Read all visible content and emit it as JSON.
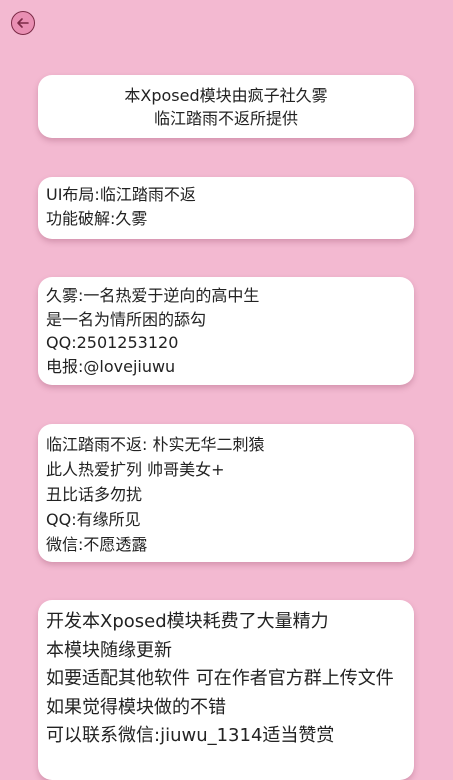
{
  "colors": {
    "background": "#f3b9d1",
    "card": "#ffffff",
    "back_button": "#e98fb3"
  },
  "toolbar": {
    "back_icon": "arrow-left-icon"
  },
  "cards": {
    "card1": {
      "lines": [
        "本Xposed模块由疯子社久雾",
        "临江踏雨不返所提供"
      ]
    },
    "card2": {
      "lines": [
        "UI布局:临江踏雨不返",
        "功能破解:久雾"
      ]
    },
    "card3": {
      "lines": [
        "久雾:一名热爱于逆向的高中生",
        "是一名为情所困的舔勾",
        "QQ:2501253120",
        "电报:@lovejiuwu"
      ]
    },
    "card4": {
      "lines": [
        "临江踏雨不返: 朴实无华二刺猿",
        "此人热爱扩列 帅哥美女+",
        "丑比话多勿扰",
        "QQ:有缘所见",
        "微信:不愿透露"
      ]
    },
    "card5": {
      "lines": [
        "开发本Xposed模块耗费了大量精力",
        "本模块随缘更新",
        "如要适配其他软件 可在作者官方群上传文件",
        "如果觉得模块做的不错",
        "可以联系微信:jiuwu_1314适当赞赏"
      ]
    }
  }
}
